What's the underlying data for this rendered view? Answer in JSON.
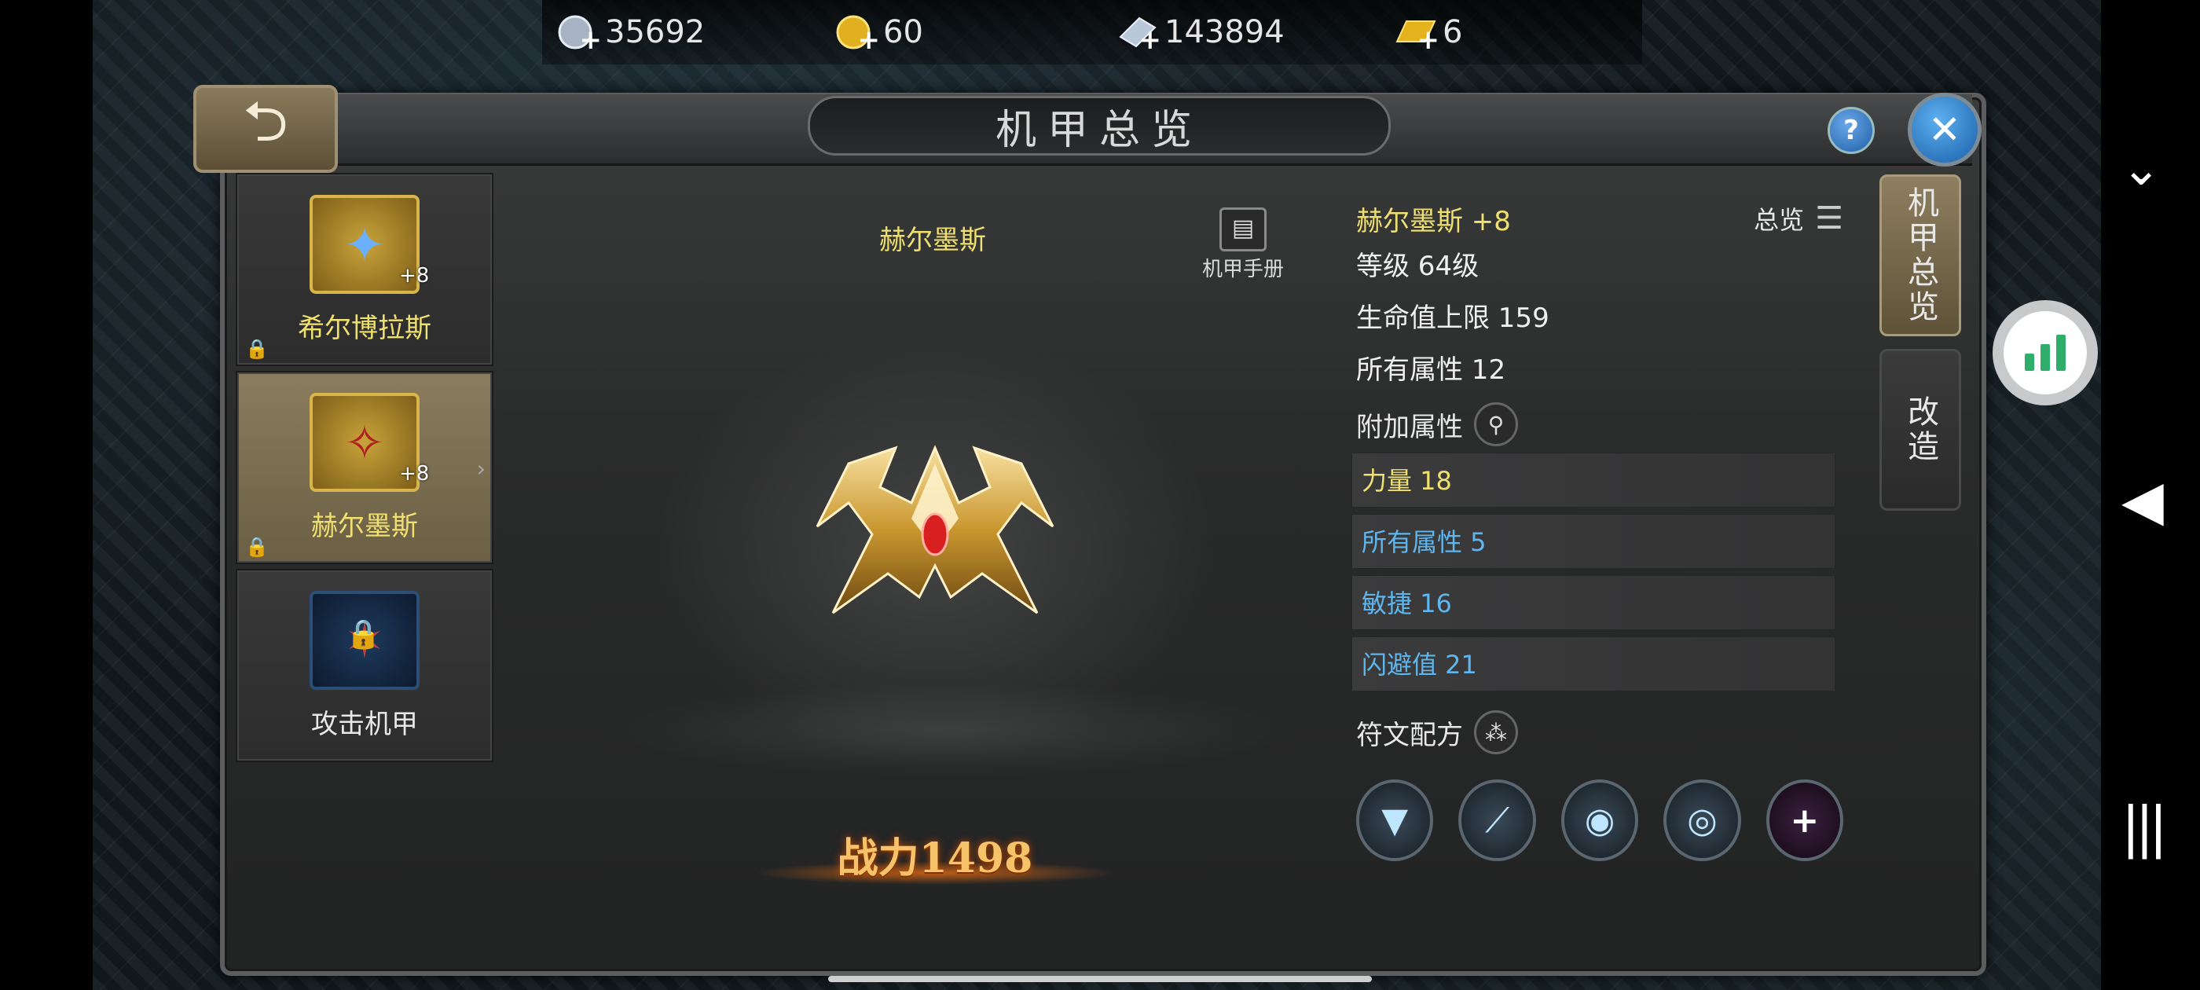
{
  "currencies": [
    {
      "icon": "silver-coin-icon",
      "value": "35692"
    },
    {
      "icon": "gold-coin-icon",
      "value": "60"
    },
    {
      "icon": "crystal-icon",
      "value": "143894"
    },
    {
      "icon": "gold-bar-icon",
      "value": "6"
    }
  ],
  "window": {
    "title": "机甲总览",
    "help": "?",
    "close": "✕",
    "back": "⮌"
  },
  "mechas": [
    {
      "name": "希尔博拉斯",
      "level": "+8",
      "locked": true,
      "selected": false
    },
    {
      "name": "赫尔墨斯",
      "level": "+8",
      "locked": true,
      "selected": true
    },
    {
      "name": "攻击机甲",
      "level": "",
      "locked": true,
      "selected": false
    }
  ],
  "center": {
    "name": "赫尔墨斯",
    "manual_label": "机甲手册",
    "power": "战力1498"
  },
  "stats": {
    "header_name": "赫尔墨斯 +8",
    "overview_label": "总览",
    "level": "等级 64级",
    "hp": "生命值上限 159",
    "all_attr": "所有属性 12",
    "additional_label": "附加属性",
    "attributes": [
      {
        "text": "力量 18",
        "color": "#f0e070"
      },
      {
        "text": "所有属性 5",
        "color": "#5fb6ee"
      },
      {
        "text": "敏捷 16",
        "color": "#5fb6ee"
      },
      {
        "text": "闪避值 21",
        "color": "#5fb6ee"
      }
    ],
    "rune_label": "符文配方",
    "runes": [
      "spike-rune-icon",
      "chain-rune-icon",
      "orb-rune-icon",
      "ring-rune-icon",
      "add-rune-icon"
    ]
  },
  "tabs": {
    "overview": "机甲总览",
    "modify": "改造"
  },
  "colors": {
    "accent_gold": "#f0e070",
    "accent_blue": "#5fb6ee"
  }
}
